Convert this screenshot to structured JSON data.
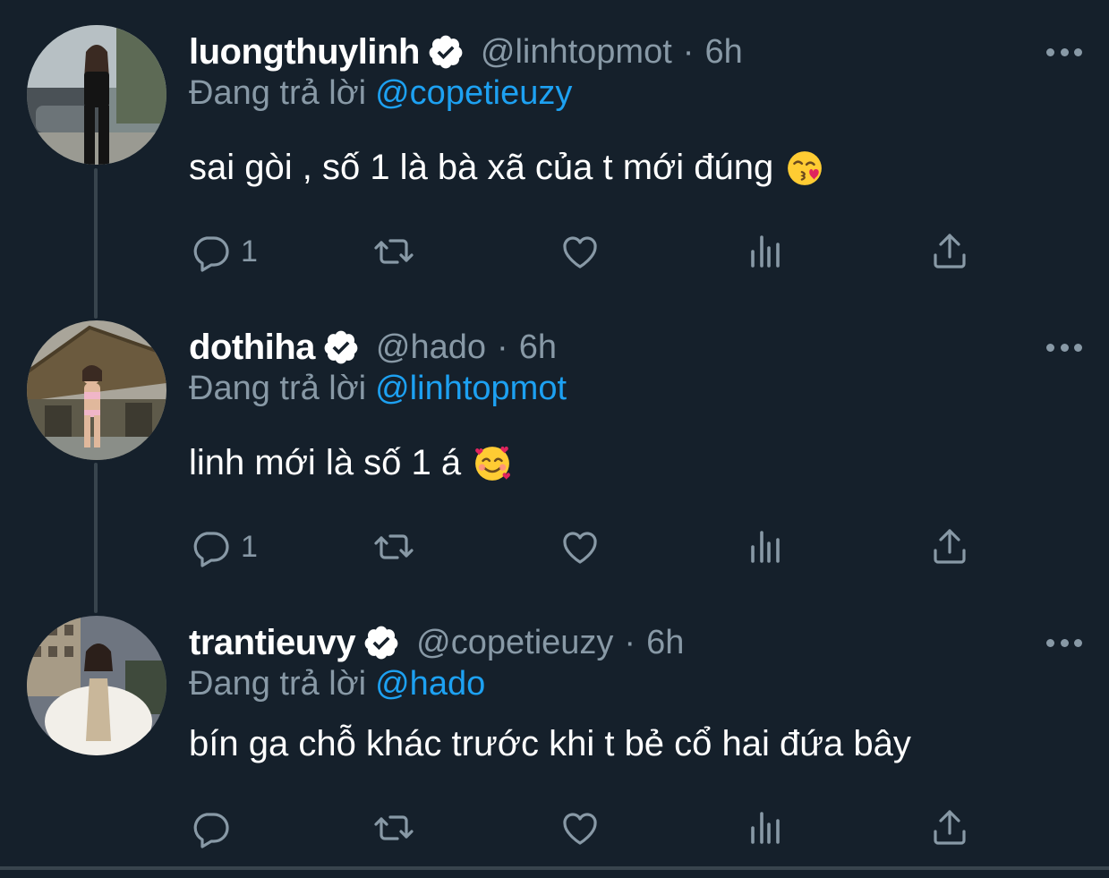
{
  "tweets": [
    {
      "display_name": "luongthuylinh",
      "handle": "@linhtopmot",
      "separator": "·",
      "time": "6h",
      "replying_prefix": "Đang trả lời",
      "replying_to": "@copetieuzy",
      "text": "sai gòi , số 1 là bà xã của t mới đúng",
      "emoji": "face-blowing-kiss-emoji",
      "reply_count": "1"
    },
    {
      "display_name": "dothiha",
      "handle": "@hado",
      "separator": "·",
      "time": "6h",
      "replying_prefix": "Đang trả lời",
      "replying_to": "@linhtopmot",
      "text": "linh mới là số 1 á",
      "emoji": "smiling-face-with-hearts-emoji",
      "reply_count": "1"
    },
    {
      "display_name": "trantieuvy",
      "handle": "@copetieuzy",
      "separator": "·",
      "time": "6h",
      "replying_prefix": "Đang trả lời",
      "replying_to": "@hado",
      "text": "bín ga chỗ khác trước khi t bẻ cổ hai đứa bây",
      "emoji": "",
      "reply_count": ""
    }
  ],
  "icons": [
    "reply-icon",
    "retweet-icon",
    "like-icon",
    "analytics-icon",
    "share-icon",
    "verified-icon",
    "more-icon"
  ],
  "colors": {
    "background": "#15202b",
    "text_primary": "#ffffff",
    "text_secondary": "#8899a6",
    "accent": "#1da1f2",
    "thread_line": "#38444d"
  }
}
